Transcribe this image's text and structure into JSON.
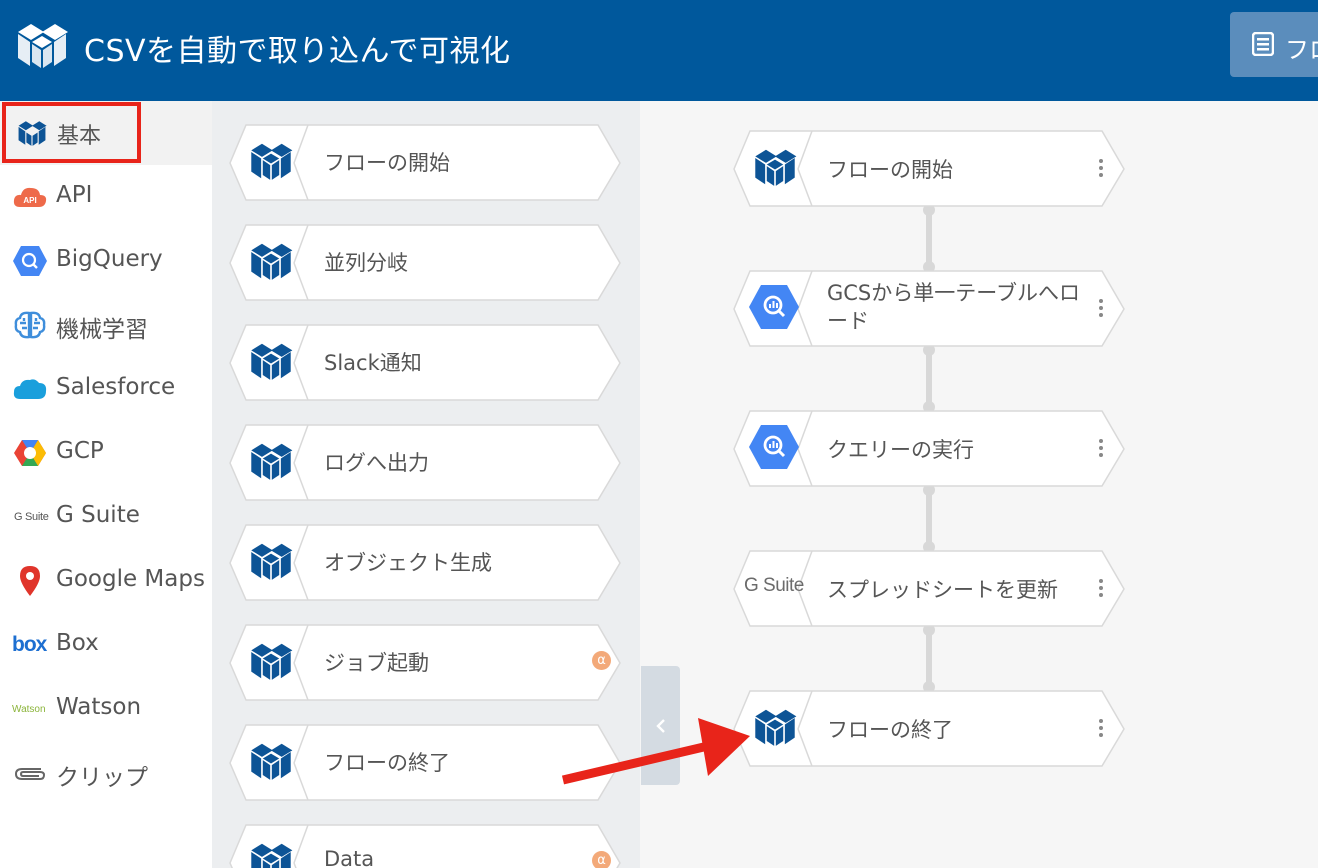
{
  "header": {
    "title": "CSVを自動で取り込んで可視化",
    "flow_button_label": "フロ"
  },
  "sidebar": {
    "items": [
      {
        "label": "基本",
        "icon": "magic-cube-icon",
        "active": true
      },
      {
        "label": "API",
        "icon": "api-cloud-icon"
      },
      {
        "label": "BigQuery",
        "icon": "bigquery-icon"
      },
      {
        "label": "機械学習",
        "icon": "brain-icon"
      },
      {
        "label": "Salesforce",
        "icon": "salesforce-cloud-icon"
      },
      {
        "label": "GCP",
        "icon": "gcp-icon"
      },
      {
        "label": "G Suite",
        "icon": "gsuite-icon",
        "icon_text": "G Suite"
      },
      {
        "label": "Google Maps",
        "icon": "map-pin-icon"
      },
      {
        "label": "Box",
        "icon": "box-logo-icon",
        "icon_text": "box"
      },
      {
        "label": "Watson",
        "icon": "watson-logo-icon",
        "icon_text": "Watson"
      },
      {
        "label": "クリップ",
        "icon": "paperclip-icon"
      }
    ]
  },
  "palette": {
    "items": [
      {
        "label": "フローの開始"
      },
      {
        "label": "並列分岐"
      },
      {
        "label": "Slack通知"
      },
      {
        "label": "ログへ出力"
      },
      {
        "label": "オブジェクト生成"
      },
      {
        "label": "ジョブ起動",
        "badge": "α"
      },
      {
        "label": "フローの終了"
      },
      {
        "label": "Data",
        "badge": "α"
      }
    ]
  },
  "flow": {
    "nodes": [
      {
        "label": "フローの開始",
        "icon": "magic-cube-icon"
      },
      {
        "label": "GCSから単一テーブルへロード",
        "icon": "bigquery-icon"
      },
      {
        "label": "クエリーの実行",
        "icon": "bigquery-icon"
      },
      {
        "label": "スプレッドシートを更新",
        "icon": "gsuite-icon",
        "icon_text": "G Suite"
      },
      {
        "label": "フローの終了",
        "icon": "magic-cube-icon"
      }
    ]
  },
  "colors": {
    "header_bg": "#00589c",
    "accent_blue": "#0d5496",
    "highlight_red": "#e8241a",
    "bigquery_blue": "#4386f4",
    "alpha_badge": "#f3a979"
  }
}
